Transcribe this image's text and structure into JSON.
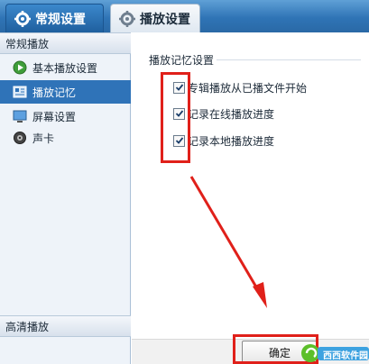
{
  "tabs": [
    {
      "label": "常规设置",
      "icon": "gear-icon"
    },
    {
      "label": "播放设置",
      "icon": "gear-icon"
    }
  ],
  "sidebar": {
    "header_top": "常规播放",
    "items": [
      {
        "label": "基本播放设置",
        "icon": "play-circle-icon"
      },
      {
        "label": "播放记忆",
        "icon": "memory-icon"
      },
      {
        "label": "屏幕设置",
        "icon": "monitor-icon"
      },
      {
        "label": "声卡",
        "icon": "speaker-icon"
      }
    ],
    "header_bottom": "高清播放"
  },
  "section": {
    "title": "播放记忆设置",
    "options": [
      {
        "label": "专辑播放从已播文件开始",
        "checked": true
      },
      {
        "label": "记录在线播放进度",
        "checked": true
      },
      {
        "label": "记录本地播放进度",
        "checked": true
      }
    ]
  },
  "footer": {
    "ok_label": "确定"
  },
  "watermark": {
    "text": "西西软件园"
  },
  "colors": {
    "highlight": "#e0201a",
    "accent": "#2f73b8"
  }
}
